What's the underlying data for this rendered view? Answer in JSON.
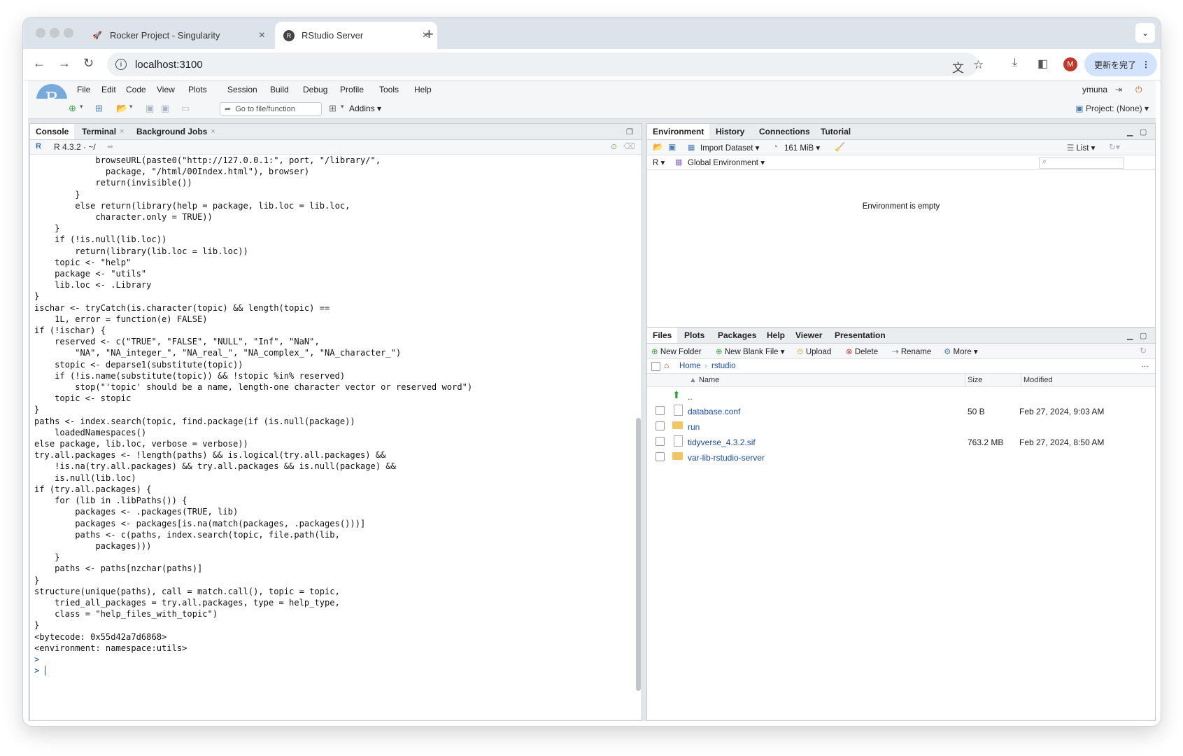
{
  "browser": {
    "tabs": [
      {
        "title": "Rocker Project - Singularity",
        "icon": "rocker-favicon"
      },
      {
        "title": "RStudio Server",
        "icon": "r-favicon"
      }
    ],
    "url": "localhost:3100",
    "update_label": "更新を完了",
    "profile_initial": "M"
  },
  "rstudio": {
    "logo": "R",
    "menu": [
      "File",
      "Edit",
      "Code",
      "View",
      "Plots",
      "Session",
      "Build",
      "Debug",
      "Profile",
      "Tools",
      "Help"
    ],
    "user": "ymuna",
    "goto_placeholder": "Go to file/function",
    "addins_label": "Addins",
    "project_label": "Project: (None)"
  },
  "console": {
    "tabs": [
      "Console",
      "Terminal",
      "Background Jobs"
    ],
    "version_label": "R 4.3.2 · ~/",
    "code": "            browseURL(paste0(\"http://127.0.0.1:\", port, \"/library/\",\n              package, \"/html/00Index.html\"), browser)\n            return(invisible())\n        }\n        else return(library(help = package, lib.loc = lib.loc,\n            character.only = TRUE))\n    }\n    if (!is.null(lib.loc))\n        return(library(lib.loc = lib.loc))\n    topic <- \"help\"\n    package <- \"utils\"\n    lib.loc <- .Library\n}\nischar <- tryCatch(is.character(topic) && length(topic) ==\n    1L, error = function(e) FALSE)\nif (!ischar) {\n    reserved <- c(\"TRUE\", \"FALSE\", \"NULL\", \"Inf\", \"NaN\",\n        \"NA\", \"NA_integer_\", \"NA_real_\", \"NA_complex_\", \"NA_character_\")\n    stopic <- deparse1(substitute(topic))\n    if (!is.name(substitute(topic)) && !stopic %in% reserved)\n        stop(\"'topic' should be a name, length-one character vector or reserved word\")\n    topic <- stopic\n}\npaths <- index.search(topic, find.package(if (is.null(package))\n    loadedNamespaces()\nelse package, lib.loc, verbose = verbose))\ntry.all.packages <- !length(paths) && is.logical(try.all.packages) &&\n    !is.na(try.all.packages) && try.all.packages && is.null(package) &&\n    is.null(lib.loc)\nif (try.all.packages) {\n    for (lib in .libPaths()) {\n        packages <- .packages(TRUE, lib)\n        packages <- packages[is.na(match(packages, .packages()))]\n        paths <- c(paths, index.search(topic, file.path(lib,\n            packages)))\n    }\n    paths <- paths[nzchar(paths)]\n}\nstructure(unique(paths), call = match.call(), topic = topic,\n    tried_all_packages = try.all.packages, type = help_type,\n    class = \"help_files_with_topic\")",
    "closing_brace": "}",
    "bytecode": "<bytecode: 0x55d42a7d6868>",
    "environment": "<environment: namespace:utils>",
    "prompt": ">"
  },
  "environment_pane": {
    "tabs": [
      "Environment",
      "History",
      "Connections",
      "Tutorial"
    ],
    "import_label": "Import Dataset",
    "memory_label": "161 MiB",
    "view_label": "List",
    "lang_label": "R",
    "scope_label": "Global Environment",
    "empty_message": "Environment is empty"
  },
  "files_pane": {
    "tabs": [
      "Files",
      "Plots",
      "Packages",
      "Help",
      "Viewer",
      "Presentation"
    ],
    "actions": [
      "New Folder",
      "New Blank File",
      "Upload",
      "Delete",
      "Rename",
      "More"
    ],
    "breadcrumb": [
      "Home",
      "rstudio"
    ],
    "columns": [
      "Name",
      "Size",
      "Modified"
    ],
    "up_label": "..",
    "rows": [
      {
        "name": "database.conf",
        "type": "file",
        "size": "50 B",
        "modified": "Feb 27, 2024, 9:03 AM"
      },
      {
        "name": "run",
        "type": "folder",
        "size": "",
        "modified": ""
      },
      {
        "name": "tidyverse_4.3.2.sif",
        "type": "file",
        "size": "763.2 MB",
        "modified": "Feb 27, 2024, 8:50 AM"
      },
      {
        "name": "var-lib-rstudio-server",
        "type": "folder",
        "size": "",
        "modified": ""
      }
    ]
  }
}
